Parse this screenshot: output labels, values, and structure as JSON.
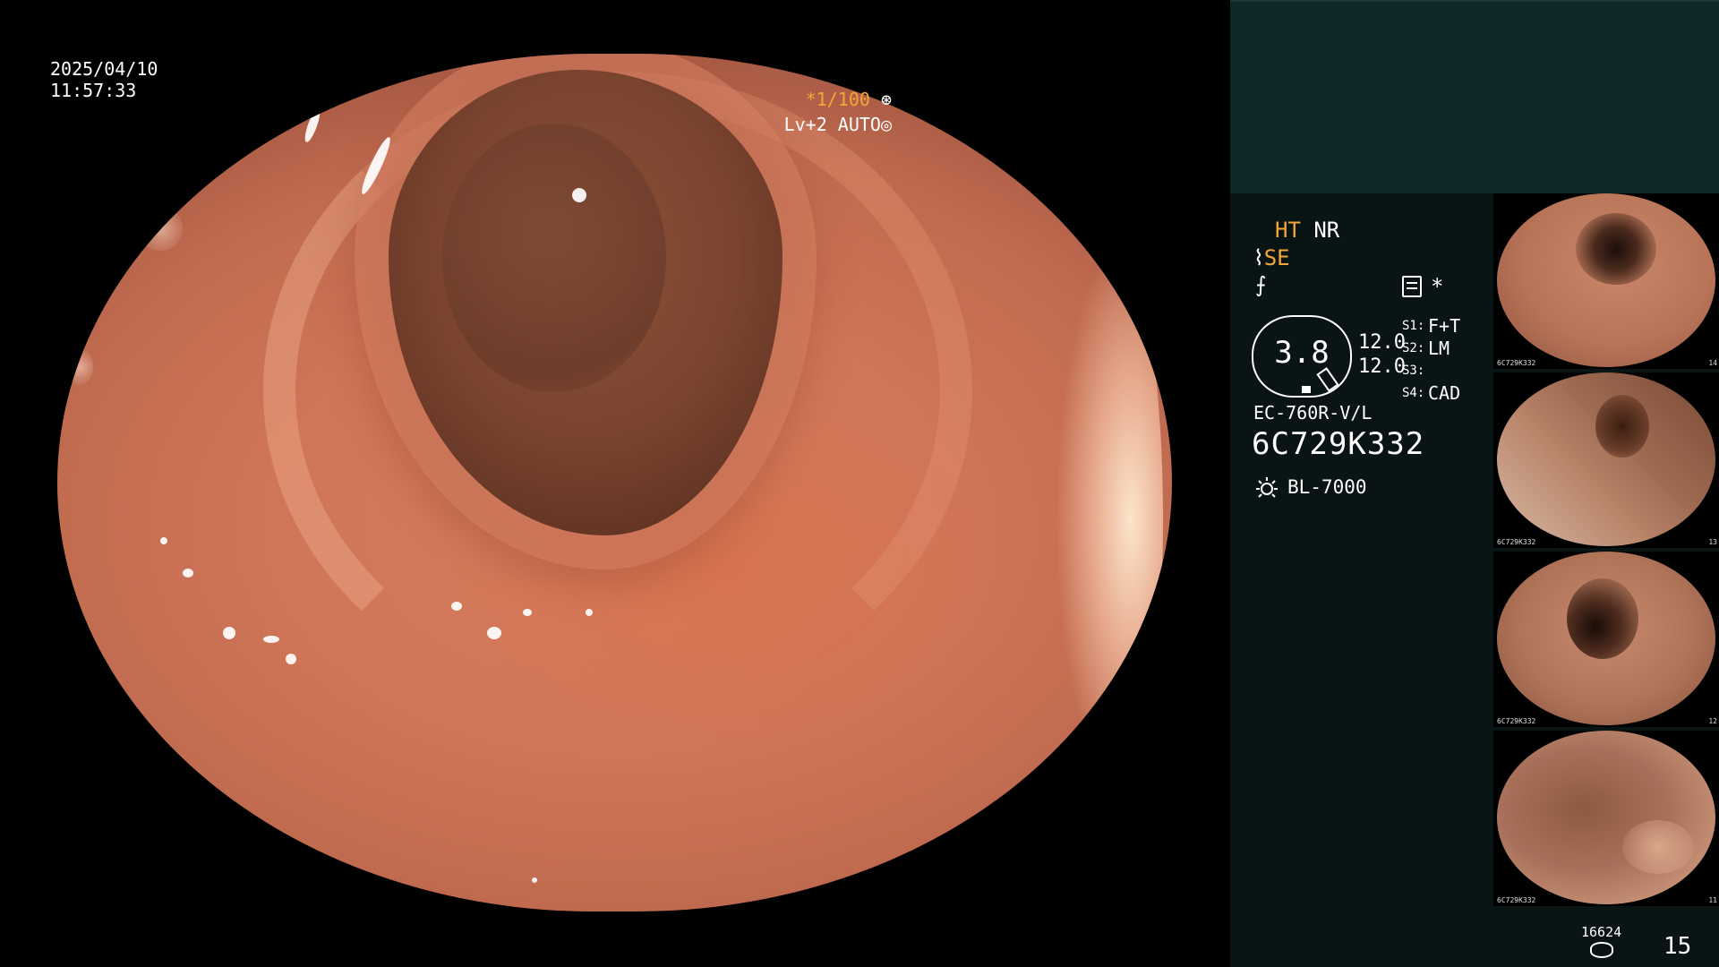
{
  "video": {
    "date": "2025/04/10",
    "time": "11:57:33",
    "shutter": "*1/100",
    "level": "Lv+2 AUTO"
  },
  "panel": {
    "ht_label": "HT",
    "nr_label": "NR",
    "se_label": "SE",
    "f_symbol": "⨍",
    "asterisk": "*",
    "zoom_value": "3.8",
    "value_1": "12.0",
    "value_2": "12.0",
    "slots": [
      {
        "label": "S1:",
        "value": "F+T"
      },
      {
        "label": "S2:",
        "value": "LM"
      },
      {
        "label": "S3:",
        "value": ""
      },
      {
        "label": "S4:",
        "value": "CAD"
      }
    ],
    "scope_model": "EC-760R-V/L",
    "scope_serial": "6C729K332",
    "light_source": "BL-7000",
    "capture_counter": "16624",
    "capture_count": "15"
  },
  "thumbnails": [
    {
      "caption": "6C729K332",
      "number": "14"
    },
    {
      "caption": "6C729K332",
      "number": "13"
    },
    {
      "caption": "6C729K332",
      "number": "12"
    },
    {
      "caption": "6C729K332",
      "number": "11"
    }
  ],
  "colors": {
    "accent_orange": "#f5a637",
    "panel_top": "#0e2828",
    "panel_body": "#091515",
    "mucosa": "#cf7558"
  }
}
